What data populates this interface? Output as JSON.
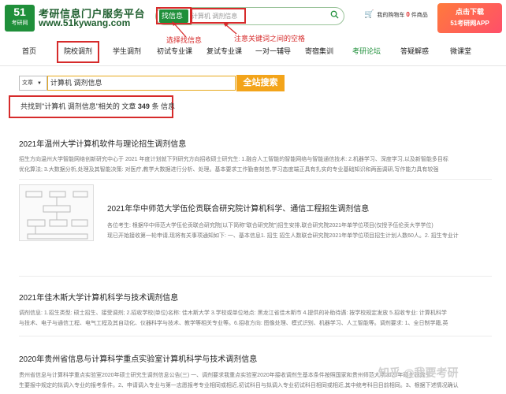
{
  "header": {
    "logo_number": "51",
    "logo_sub": "考研网",
    "site_name": "考研信息门户服务平台",
    "site_url": "www.51kywang.com",
    "search_type": "找信息",
    "search_value": "计算机 调剂信息",
    "cart_prefix": "我的购物车",
    "cart_count": "0",
    "cart_suffix": "件商品",
    "app_line1": "点击下载",
    "app_line2": "51考研网APP"
  },
  "annotations": {
    "select_info": "选择找信息",
    "space_note": "注意关键词之间的空格"
  },
  "nav": {
    "items": [
      "首页",
      "院校调剂",
      "学生调剂",
      "初试专业课",
      "复试专业课",
      "一对一辅导",
      "寄宿集训",
      "考研论坛",
      "答疑解惑",
      "微课堂"
    ]
  },
  "search": {
    "type_label": "文章",
    "value": "计算机 调剂信息",
    "button": "全站搜索"
  },
  "result": {
    "prefix": "共找到\"计算机 调剂信息\"相关的 文章",
    "count": "349",
    "suffix": "条 信息"
  },
  "articles": [
    {
      "title": "2021年温州大学计算机软件与理论招生调剂信息",
      "lines": [
        "招生方向温州大学智能网络创新研究中心于 2021 年度计划就下列研究方向招收硕士研究生: 1.融合人工智能的智能网络与智能通信技术: 2.机器学习、深度学习,以及新智能多目标",
        "优化算法; 3.大数据分析,处理及其智能决策: 对医疗,教学大数据进行分析、处理。基本要求工作勤奋刻苦,学习态度端正具有扎实的专业基础知识和两面调研,写作能力具有较强"
      ]
    },
    {
      "title": "2021年华中师范大学伍伦贡联合研究院计算机科学、通信工程招生调剂信息",
      "lines": [
        "各位考生: 根据华中师范大学伍伦贡联合研究院(以下简称\"联合研究院\")招生安排,联合研究院2021年单学位项目(仅授予伍伦贡大学学位)",
        "现已开始接收第一轮申请,现将有关事项通知如下: 一、基本信息1. 招生 招生人数联合研究院2021年单学位项目招生计划人数60人。2. 招生专业计"
      ]
    },
    {
      "title": "2021年佳木斯大学计算机科学与技术调剂信息",
      "lines": [
        "调剂信息: 1.招生类型: 硕士招生、接受调剂; 2.招收学校(单位)名称: 佳木斯大学 3.学校或单位地点: 黑龙江省佳木斯市 4.提供的补助待遇: 按学校规定发放 5.招收专业: 计算机科学",
        "与技术、电子与通信工程、电气工程及其自动化、仪器科学与技术、教学等相关专业等。6.招收方向: 图像处理、模式识别、机器学习、人工智能等。调剂要求: 1、全日制学籍,英"
      ]
    },
    {
      "title": "2020年贵州省信息与计算科学重点实验室计算机科学与技术调剂信息",
      "lines": [
        "贵州省信息与计算科学重点实验室2020年硕士研究生调剂信息公告(三) 一、调剂要求我重点实验室2020年接收调剂生基本条件按照国家和贵州师范大学2020年硕士研究生",
        "生要报中规定的拟调入专业的报考条件。2、申请调入专业与第一志愿报考专业相同或相近,初试科目与拟调入专业初试科目相同或相近,其中统考科目目前相同。3、根据下述情况确认"
      ]
    }
  ],
  "watermark": "知乎 @我要考研"
}
